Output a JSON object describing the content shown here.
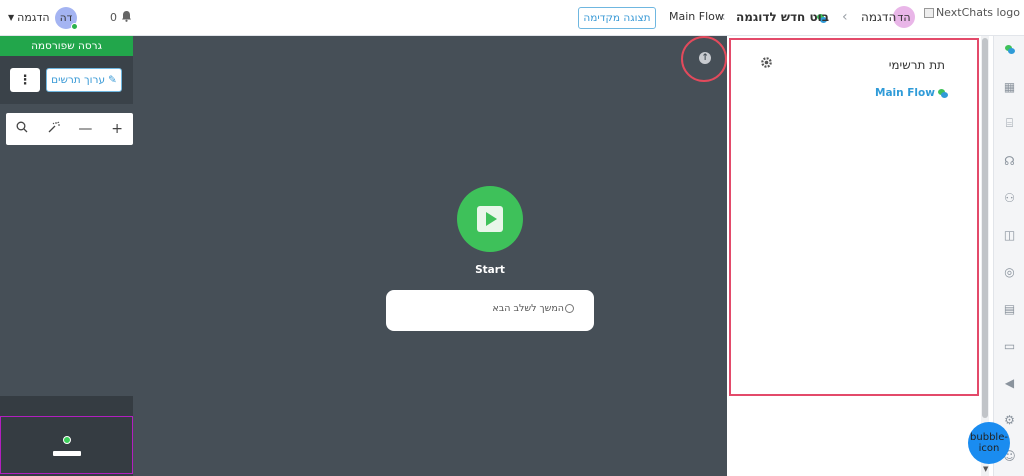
{
  "header": {
    "logo_alt": "NextChats logo",
    "workspace_initials": "הד",
    "workspace_name": "הדגמה",
    "bot_name": "בוט חדש לדוגמה",
    "flow_name": "Main Flow",
    "preview_label": "תצוגה מקדימה",
    "user_initials": "דה",
    "user_name": "הדגמה",
    "notification_count": "0"
  },
  "left_panel": {
    "published_label": "גרסה שפורסמה",
    "edit_label": "ערוך תרשים"
  },
  "canvas": {
    "start_label": "Start",
    "next_step_label": "המשך לשלב הבא"
  },
  "right_panel": {
    "subflows_title": "תת תרשימי",
    "flows": [
      {
        "label": "Main Flow"
      }
    ]
  },
  "bubble_label": "bubble-icon",
  "colors": {
    "accent": "#3a9ad6",
    "published": "#22a64b",
    "start": "#3ec15a",
    "highlight": "#e34a6a",
    "canvas": "#464f57"
  },
  "rail_icons": [
    "chat-icon",
    "grid-icon",
    "presentation-icon",
    "headset-icon",
    "user-icon",
    "columns-icon",
    "globe-icon",
    "chart-icon",
    "archive-icon",
    "megaphone-icon",
    "settings-icon",
    "support-icon"
  ]
}
